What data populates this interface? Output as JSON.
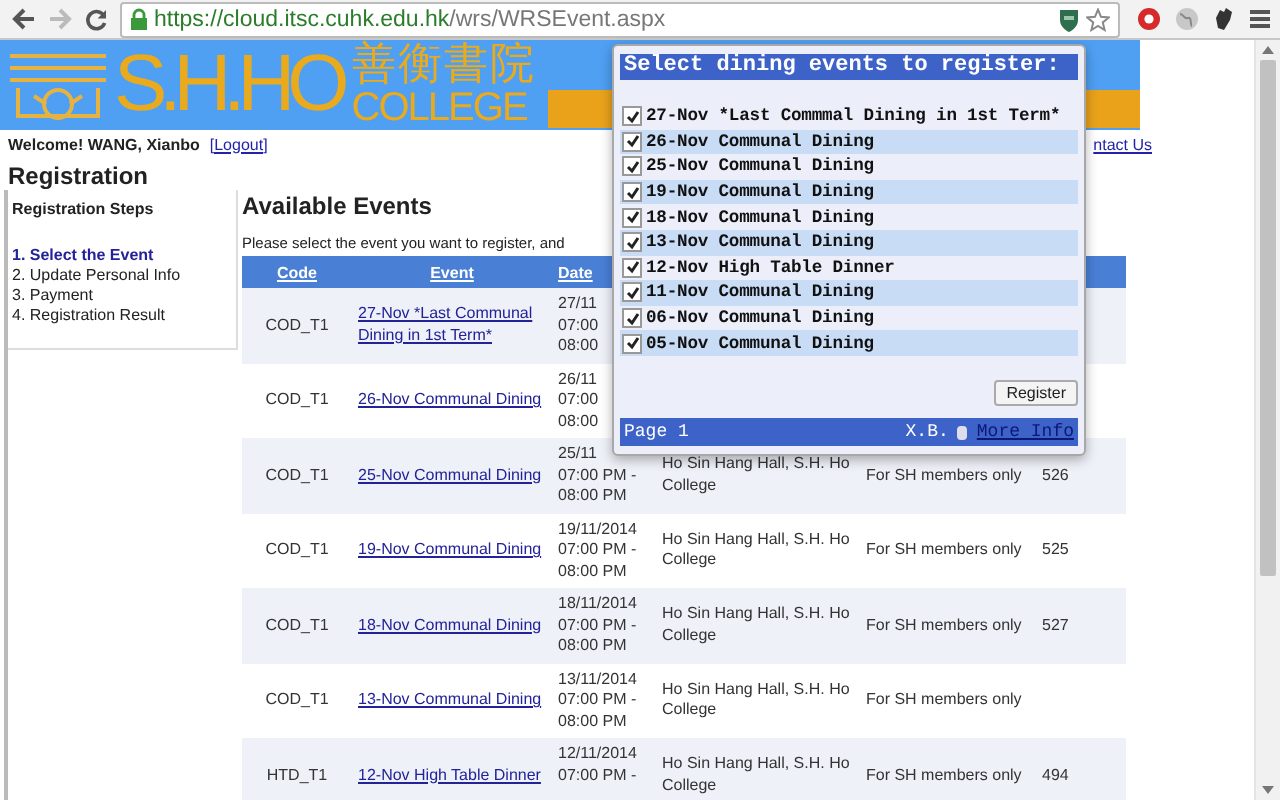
{
  "browser": {
    "url_host": "https://cloud.itsc.cuhk.edu.hk",
    "url_path": "/wrs/WRSEvent.aspx"
  },
  "banner": {
    "title": "S.H.HO",
    "chinese_name": "善衡書院",
    "subtitle": "COLLEGE"
  },
  "header": {
    "welcome": "Welcome! WANG, Xianbo",
    "logout": "[Logout]",
    "contact": "ntact Us"
  },
  "sidebar": {
    "title": "Registration",
    "box_title": "Registration Steps",
    "steps": [
      {
        "label": "1. Select the Event",
        "selected": true
      },
      {
        "label": "2. Update Personal Info",
        "selected": false
      },
      {
        "label": "3. Payment",
        "selected": false
      },
      {
        "label": "4. Registration Result",
        "selected": false
      }
    ]
  },
  "main": {
    "heading": "Available Events",
    "instruction": "Please select the event you want to register, and",
    "table": {
      "columns": [
        "Code",
        "Event",
        "Date"
      ],
      "rows": [
        {
          "code": "COD_T1",
          "event": "27-Nov *Last Communal Dining in 1st Term*",
          "date": [
            "27/11",
            "07:00",
            "08:00"
          ]
        },
        {
          "code": "COD_T1",
          "event": "26-Nov Communal Dining",
          "date": [
            "26/11",
            "07:00",
            "08:00"
          ]
        },
        {
          "code": "COD_T1",
          "event": "25-Nov Communal Dining",
          "date": [
            "25/11",
            "07:00 PM -",
            "08:00 PM"
          ],
          "venue": "Ho Sin Hang Hall, S.H. Ho College",
          "remark": "For SH members only",
          "number": "526"
        },
        {
          "code": "COD_T1",
          "event": "19-Nov Communal Dining",
          "date": [
            "19/11/2014",
            "07:00 PM -",
            "08:00 PM"
          ],
          "venue": "Ho Sin Hang Hall, S.H. Ho College",
          "remark": "For SH members only",
          "number": "525"
        },
        {
          "code": "COD_T1",
          "event": "18-Nov Communal Dining",
          "date": [
            "18/11/2014",
            "07:00 PM -",
            "08:00 PM"
          ],
          "venue": "Ho Sin Hang Hall, S.H. Ho College",
          "remark": "For SH members only",
          "number": "527"
        },
        {
          "code": "COD_T1",
          "event": "13-Nov Communal Dining",
          "date": [
            "13/11/2014",
            "07:00 PM -",
            "08:00 PM"
          ],
          "venue": "Ho Sin Hang Hall, S.H. Ho College",
          "remark": "For SH members only"
        },
        {
          "code": "HTD_T1",
          "event": "12-Nov High Table Dinner",
          "date": [
            "12/11/2014",
            "07:00 PM -"
          ],
          "venue": "Ho Sin Hang Hall, S.H. Ho College",
          "remark": "For SH members only",
          "number": "494"
        }
      ]
    }
  },
  "popup": {
    "title": "Select dining events to register:",
    "events": [
      {
        "label": "27-Nov *Last Commmal Dining in 1st Term*",
        "checked": true
      },
      {
        "label": "26-Nov Communal Dining",
        "checked": true
      },
      {
        "label": "25-Nov Communal Dining",
        "checked": true
      },
      {
        "label": "19-Nov Communal Dining",
        "checked": true
      },
      {
        "label": "18-Nov Communal Dining",
        "checked": true
      },
      {
        "label": "13-Nov Communal Dining",
        "checked": true
      },
      {
        "label": "12-Nov High Table Dinner",
        "checked": true
      },
      {
        "label": "11-Nov Communal Dining",
        "checked": true
      },
      {
        "label": "06-Nov Communal Dining",
        "checked": true
      },
      {
        "label": "05-Nov Communal Dining",
        "checked": true
      }
    ],
    "register_button": "Register",
    "footer_page": "Page 1",
    "footer_author": "X.B.",
    "footer_link": "More Info"
  }
}
